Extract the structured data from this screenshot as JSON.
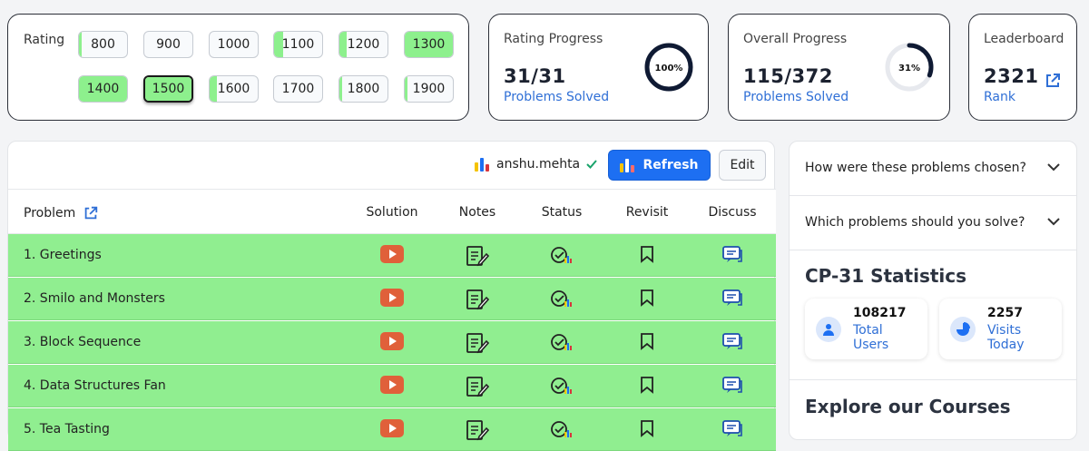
{
  "rating": {
    "label": "Rating",
    "buttons": [
      {
        "value": "800",
        "solved_fraction": 0.06
      },
      {
        "value": "900",
        "solved_fraction": 0.0
      },
      {
        "value": "1000",
        "solved_fraction": 0.0
      },
      {
        "value": "1100",
        "solved_fraction": 0.18
      },
      {
        "value": "1200",
        "solved_fraction": 0.15
      },
      {
        "value": "1300",
        "solved_fraction": 1.0
      },
      {
        "value": "1400",
        "solved_fraction": 1.0
      },
      {
        "value": "1500",
        "solved_fraction": 1.0,
        "selected": true
      },
      {
        "value": "1600",
        "solved_fraction": 0.15
      },
      {
        "value": "1700",
        "solved_fraction": 0.0
      },
      {
        "value": "1800",
        "solved_fraction": 0.05
      },
      {
        "value": "1900",
        "solved_fraction": 0.05
      }
    ]
  },
  "rating_progress": {
    "title": "Rating Progress",
    "count": "31/31",
    "sub": "Problems Solved",
    "percent_label": "100%",
    "percent": 100
  },
  "overall_progress": {
    "title": "Overall Progress",
    "count": "115/372",
    "sub": "Problems Solved",
    "percent_label": "31%",
    "percent": 31
  },
  "leaderboard": {
    "title": "Leaderboard",
    "rank_value": "2321",
    "rank_label": "Rank"
  },
  "toolbar": {
    "username": "anshu.mehta",
    "refresh_label": "Refresh",
    "edit_label": "Edit"
  },
  "table": {
    "headers": {
      "problem": "Problem",
      "solution": "Solution",
      "notes": "Notes",
      "status": "Status",
      "revisit": "Revisit",
      "discuss": "Discuss"
    },
    "rows": [
      {
        "name": "1. Greetings"
      },
      {
        "name": "2. Smilo and Monsters"
      },
      {
        "name": "3. Block Sequence"
      },
      {
        "name": "4. Data Structures Fan"
      },
      {
        "name": "5. Tea Tasting"
      }
    ]
  },
  "side": {
    "faq": [
      {
        "question": "How were these problems chosen?"
      },
      {
        "question": "Which problems should you solve?"
      }
    ],
    "stats_title": "CP-31 Statistics",
    "stats": [
      {
        "value": "108217",
        "line1": "Total",
        "line2": "Users",
        "icon": "user-icon"
      },
      {
        "value": "2257",
        "line1": "Visits",
        "line2": "Today",
        "icon": "pie-chart-icon"
      }
    ],
    "explore_title": "Explore our Courses"
  },
  "colors": {
    "solved_green": "#90ee90",
    "accent_blue": "#1d6ff2",
    "link_blue": "#2f6fd6",
    "youtube_red": "#e0603a"
  }
}
